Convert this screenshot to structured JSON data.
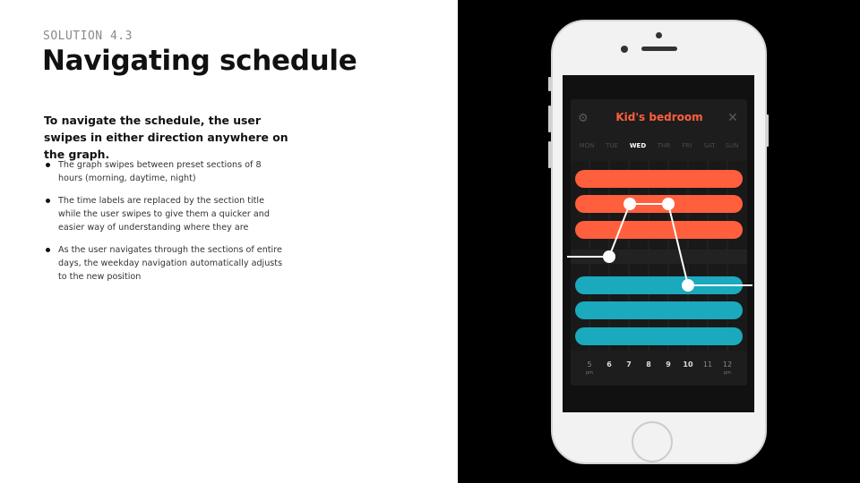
{
  "slide": {
    "kicker": "SOLUTION 4.3",
    "title": "Navigating schedule",
    "lead": "To navigate the schedule, the user swipes in either direction anywhere on the graph.",
    "bullets": [
      "The graph swipes between preset sections of 8 hours (morning, daytime, night)",
      "The time labels are replaced by the section title while the user swipes to give them a quicker and easier way of understanding where they are",
      "As the user navigates through the sections of entire days, the weekday navigation automatically adjusts to the new position"
    ]
  },
  "app": {
    "room_title": "Kid's bedroom",
    "settings_icon": "gear-icon",
    "close_icon": "close-icon",
    "days": [
      "MON",
      "TUE",
      "WED",
      "THR",
      "FRI",
      "SAT",
      "SUN"
    ],
    "active_day": "WED",
    "hours": [
      {
        "label": "5",
        "sub": "pm"
      },
      {
        "label": "6",
        "sub": ""
      },
      {
        "label": "7",
        "sub": ""
      },
      {
        "label": "8",
        "sub": ""
      },
      {
        "label": "9",
        "sub": ""
      },
      {
        "label": "10",
        "sub": ""
      },
      {
        "label": "11",
        "sub": ""
      },
      {
        "label": "12",
        "sub": "pm"
      }
    ],
    "colors": {
      "warm": "#ff5f3c",
      "cool": "#1ba9be",
      "line": "#ffffff"
    }
  }
}
